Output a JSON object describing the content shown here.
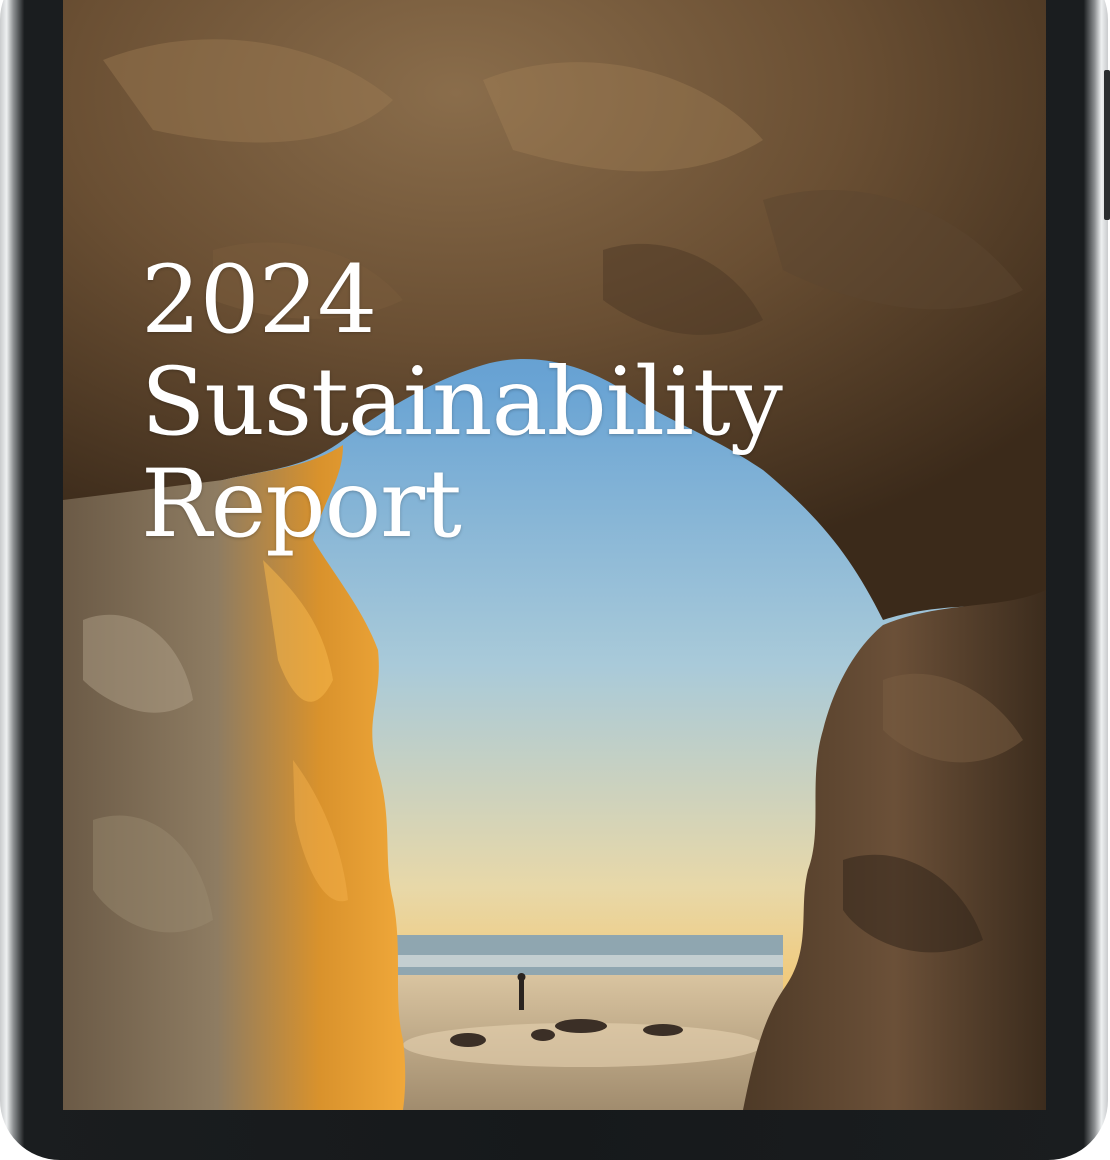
{
  "cover": {
    "year": "2024",
    "title_line1": "Sustainability",
    "title_line2": "Report"
  },
  "icons": {
    "photo": "sea-cave-photo"
  }
}
